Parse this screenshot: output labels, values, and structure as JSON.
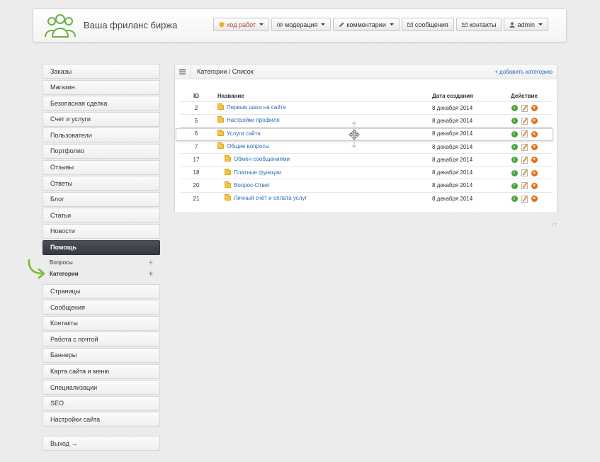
{
  "header": {
    "brand": "Ваша фриланс биржа",
    "nav": [
      {
        "label": "ход работ",
        "icon": "shield-icon",
        "dropdown": true,
        "style": "warn"
      },
      {
        "label": "модерация",
        "icon": "eye-icon",
        "dropdown": true
      },
      {
        "label": "комментарии",
        "icon": "pencil-icon",
        "dropdown": true
      },
      {
        "label": "сообщения",
        "icon": "envelope-icon",
        "dropdown": false
      },
      {
        "label": "контакты",
        "icon": "envelope-icon",
        "dropdown": false
      },
      {
        "label": "admin",
        "icon": "user-icon",
        "dropdown": true
      }
    ]
  },
  "sidebar": {
    "items_top": [
      "Заказы",
      "Магазин",
      "Безопасная сделка",
      "Счет и услуги",
      "Пользователи",
      "Портфолио",
      "Отзывы",
      "Ответы",
      "Блог",
      "Статьи",
      "Новости"
    ],
    "active": "Помощь",
    "sub_items": [
      {
        "label": "Вопросы",
        "bold": false
      },
      {
        "label": "Категории",
        "bold": true
      }
    ],
    "items_bottom": [
      "Страницы",
      "Сообщения",
      "Контакты",
      "Работа с почтой",
      "Баннеры",
      "Карта сайта и меню",
      "Специализации",
      "SEO",
      "Настройки сайта"
    ],
    "exit": "Выход →"
  },
  "panel": {
    "breadcrumb": "Категории / Список",
    "add_link": "+ добавить категорию",
    "columns": {
      "id": "ID",
      "name": "Название",
      "date": "Дата создания",
      "actions": "Действие"
    },
    "rows": [
      {
        "id": "2",
        "name": "Первые шаги на сайте",
        "date": "8 декабря 2014",
        "level": 0
      },
      {
        "id": "5",
        "name": "Настройки профиля",
        "date": "8 декабря 2014",
        "level": 0
      },
      {
        "id": "6",
        "name": "Услуги сайта",
        "date": "8 декабря 2014",
        "level": 0,
        "highlight": true
      },
      {
        "id": "7",
        "name": "Общие вопросы",
        "date": "8 декабря 2014",
        "level": 0
      },
      {
        "id": "17",
        "name": "Обмен сообщениями",
        "date": "8 декабря 2014",
        "level": 1
      },
      {
        "id": "18",
        "name": "Платные функции",
        "date": "8 декабря 2014",
        "level": 1
      },
      {
        "id": "20",
        "name": "Вопрос-Ответ",
        "date": "8 декабря 2014",
        "level": 1
      },
      {
        "id": "21",
        "name": "Личный счёт и оплата услуг",
        "date": "8 декабря 2014",
        "level": 1
      }
    ],
    "sort_hint": "↓↑"
  },
  "colors": {
    "accent": "#2a6fb5",
    "active_bg": "#3d424a",
    "logo_green": "#6ab04c"
  }
}
